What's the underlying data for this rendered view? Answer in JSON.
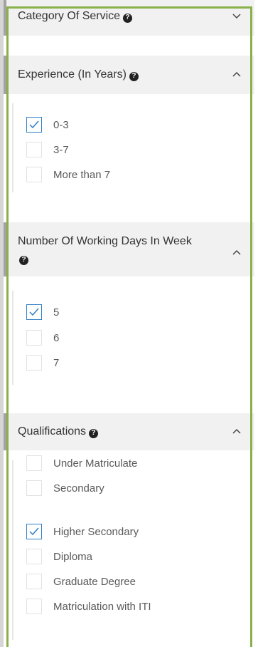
{
  "filters": {
    "category": {
      "title": "Category Of Service",
      "help_icon": "question-circle-icon",
      "chevron": "chevron-down-icon"
    },
    "experience": {
      "title": "Experience (In Years)",
      "help_icon": "question-circle-icon",
      "chevron": "chevron-up-icon",
      "options": [
        {
          "label": "0-3",
          "checked": true
        },
        {
          "label": "3-7",
          "checked": false
        },
        {
          "label": "More than 7",
          "checked": false
        }
      ]
    },
    "working_days": {
      "title_line1": "Number Of Working Days In Week",
      "help_icon": "question-circle-icon",
      "chevron": "chevron-up-icon",
      "options": [
        {
          "label": "5",
          "checked": true
        },
        {
          "label": "6",
          "checked": false
        },
        {
          "label": "7",
          "checked": false
        }
      ]
    },
    "qualifications": {
      "title": "Qualifications",
      "help_icon": "question-circle-icon",
      "chevron": "chevron-up-icon",
      "options": [
        {
          "label": "Under Matriculate",
          "checked": false
        },
        {
          "label": "Secondary",
          "checked": false
        },
        {
          "label": "Higher Secondary",
          "checked": true
        },
        {
          "label": "Diploma",
          "checked": false
        },
        {
          "label": "Graduate Degree",
          "checked": false
        },
        {
          "label": "Matriculation with ITI",
          "checked": false
        }
      ]
    }
  },
  "colors": {
    "frame_green": "#8ab04a",
    "check_blue": "#2f7fc7",
    "header_bg": "#f1f1f1"
  }
}
